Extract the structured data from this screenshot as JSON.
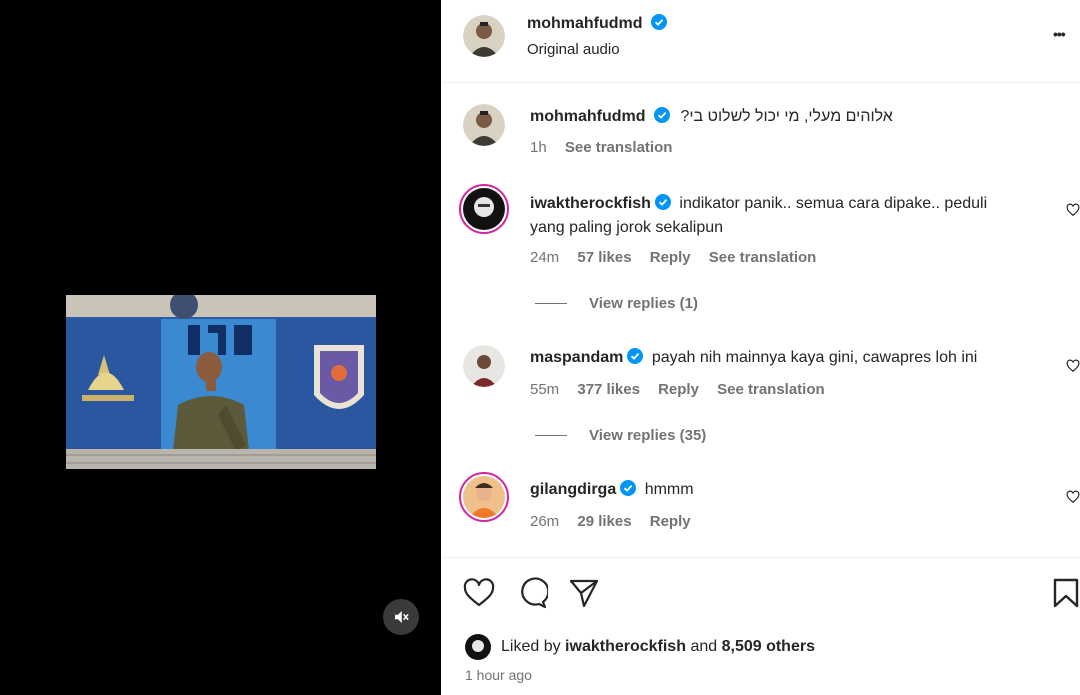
{
  "post": {
    "author": "mohmahfudmd",
    "audio": "Original audio",
    "more": "•••",
    "caption": "אלוהים מעלי, מי יכול לשלוט בי?",
    "caption_time": "1h",
    "see_translation": "See translation"
  },
  "comments": [
    {
      "user": "iwaktherockfish",
      "text_line1": "indikator panik.. semua cara dipake.. peduli",
      "text_line2": "yang paling jorok sekalipun",
      "time": "24m",
      "likes": "57 likes",
      "reply": "Reply",
      "see_translation": "See translation",
      "view_replies": "View replies (1)"
    },
    {
      "user": "maspandam",
      "text": "payah nih mainnya kaya gini, cawapres loh ini",
      "time": "55m",
      "likes": "377 likes",
      "reply": "Reply",
      "see_translation": "See translation",
      "view_replies": "View replies (35)"
    },
    {
      "user": "gilangdirga",
      "text": "hmmm",
      "time": "26m",
      "likes": "29 likes",
      "reply": "Reply"
    }
  ],
  "footer": {
    "liked_by_prefix": "Liked by",
    "liked_by_user": "iwaktherockfish",
    "and": "and",
    "others": "8,509 others",
    "time_ago": "1 hour ago"
  },
  "icons": {
    "verified": "verified-badge-icon",
    "like": "heart-icon",
    "comment": "comment-bubble-icon",
    "share": "paper-plane-icon",
    "save": "bookmark-icon",
    "mute": "muted-speaker-icon"
  },
  "colors": {
    "verified": "#0095f6",
    "story_ring": "#d6249f",
    "secondary_text": "#737373"
  }
}
